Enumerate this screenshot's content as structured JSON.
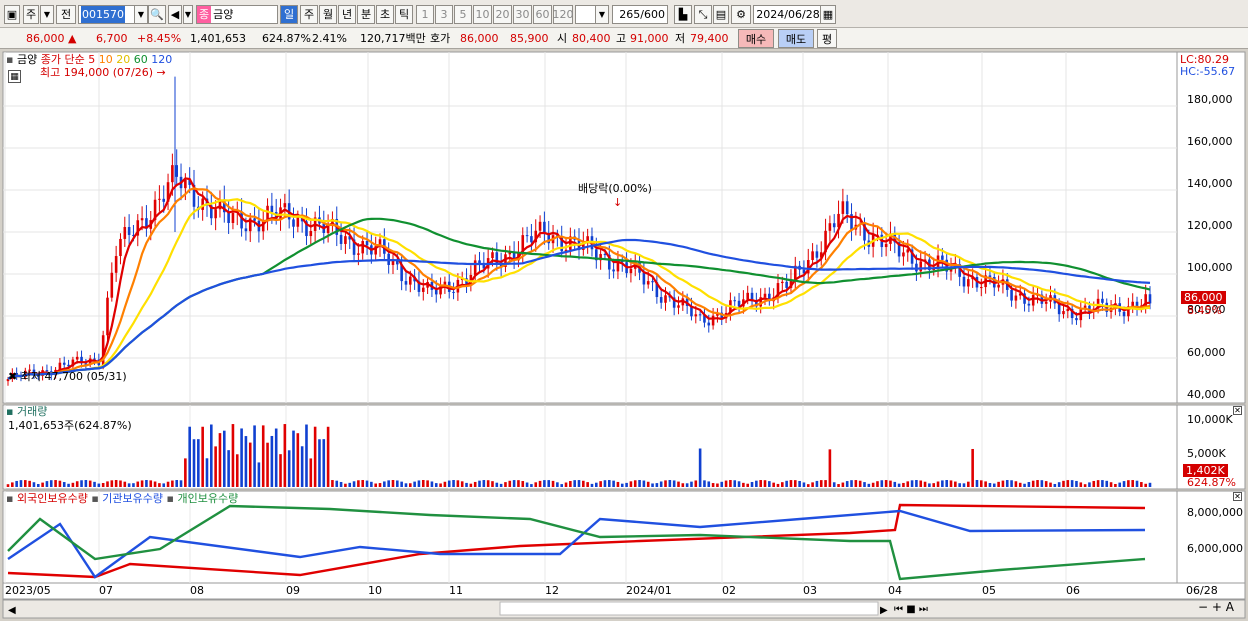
{
  "toolbar": {
    "market_toggle": "주",
    "prev_label": "전",
    "code": "001570",
    "name_badge": "종",
    "name": "금양",
    "periods": [
      "일",
      "주",
      "월",
      "년",
      "분",
      "초",
      "틱"
    ],
    "active_period": "일",
    "intervals": [
      "1",
      "3",
      "5",
      "10",
      "20",
      "30",
      "60",
      "120"
    ],
    "count": "265",
    "count_total": "/600",
    "date": "2024/06/28"
  },
  "quote": {
    "price": "86,000",
    "change": "6,700",
    "change_pct": "+8.45%",
    "volume": "1,401,653",
    "volume_ratio": "624.87%",
    "turnover_rate": "2.41%",
    "amount": "120,717백만",
    "ask_label": "호가",
    "ask": "86,000",
    "bid": "85,900",
    "open_label": "시",
    "open": "80,400",
    "high_label": "고",
    "high": "91,000",
    "low_label": "저",
    "low": "79,400",
    "buy": "매수",
    "sell": "매도",
    "avg": "평"
  },
  "price_panel": {
    "stock": "금양",
    "ma_label": "종가 단순",
    "ma_periods": [
      "5",
      "10",
      "20",
      "60",
      "120"
    ],
    "ma_colors": [
      "#e00000",
      "#ff8000",
      "#ffe000",
      "#109030",
      "#2050e0"
    ],
    "high_marker": "최고 194,000 (07/26)",
    "low_marker": "최저 47,700 (05/31)",
    "dividend": "배당락(0.00%)",
    "lc": "LC:80.29",
    "hc": "HC:-55.67",
    "y_ticks": [
      "180,000",
      "160,000",
      "140,000",
      "120,000",
      "100,000",
      "80,000",
      "60,000",
      "40,000"
    ],
    "last_price": "86,000",
    "last_pct": "8.45%"
  },
  "volume_panel": {
    "title": "거래량",
    "value": "1,401,653주(624.87%)",
    "y_ticks": [
      "10,000K",
      "5,000K"
    ],
    "last": "1,402K",
    "last_pct": "624.87%"
  },
  "holding_panel": {
    "series": [
      "외국인보유수량",
      "기관보유수량",
      "개인보유수량"
    ],
    "series_colors": [
      "#e00000",
      "#2050e0",
      "#209040"
    ],
    "y_ticks": [
      "8,000,000",
      "6,000,000"
    ]
  },
  "x_axis": [
    "2023/05",
    "07",
    "08",
    "09",
    "10",
    "11",
    "12",
    "2024/01",
    "02",
    "03",
    "04",
    "05",
    "06",
    "06/28"
  ],
  "chart_data": {
    "type": "candlestick",
    "price_range": [
      40000,
      194000
    ],
    "approx_close_path": [
      {
        "x": "2023/05",
        "y": 50000
      },
      {
        "x": "07",
        "y": 60000
      },
      {
        "x": "07",
        "y": 110000
      },
      {
        "x": "08",
        "y": 145000
      },
      {
        "x": "08",
        "y": 125000
      },
      {
        "x": "09",
        "y": 128000
      },
      {
        "x": "10",
        "y": 110000
      },
      {
        "x": "11",
        "y": 90000
      },
      {
        "x": "11",
        "y": 100000
      },
      {
        "x": "12",
        "y": 120000
      },
      {
        "x": "2024/01",
        "y": 105000
      },
      {
        "x": "02",
        "y": 78000
      },
      {
        "x": "03",
        "y": 95000
      },
      {
        "x": "03",
        "y": 128000
      },
      {
        "x": "04",
        "y": 110000
      },
      {
        "x": "05",
        "y": 95000
      },
      {
        "x": "06",
        "y": 82000
      },
      {
        "x": "06/28",
        "y": 86000
      }
    ]
  }
}
